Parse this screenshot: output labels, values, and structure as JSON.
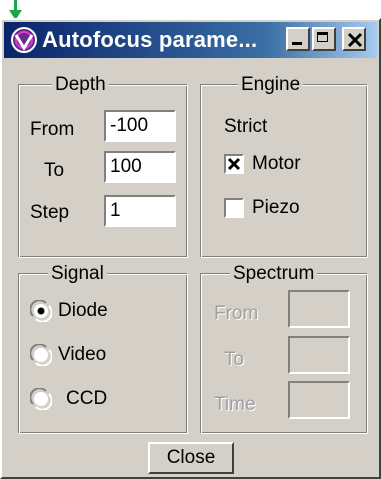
{
  "window": {
    "title": "Autofocus parame..."
  },
  "depth": {
    "legend": "Depth",
    "from_label": "From",
    "from_value": "-100",
    "to_label": "To",
    "to_value": "100",
    "step_label": "Step",
    "step_value": "1"
  },
  "engine": {
    "legend": "Engine",
    "strict_label": "Strict",
    "motor_label": "Motor",
    "motor_checked": true,
    "piezo_label": "Piezo",
    "piezo_checked": false
  },
  "signal": {
    "legend": "Signal",
    "selected": "Diode",
    "options": [
      "Diode",
      "Video",
      "CCD"
    ]
  },
  "spectrum": {
    "legend": "Spectrum",
    "from_label": "From",
    "to_label": "To",
    "time_label": "Time",
    "enabled": false
  },
  "footer": {
    "close_label": "Close"
  },
  "icons": {
    "arrow": "green-down-arrow-icon",
    "app": "app-logo-icon",
    "minimize": "minimize-icon",
    "maximize": "maximize-icon",
    "close": "close-icon"
  },
  "colors": {
    "title_bar": "#0a246a",
    "face": "#d4d0c8",
    "arrow": "#1aa64a"
  }
}
